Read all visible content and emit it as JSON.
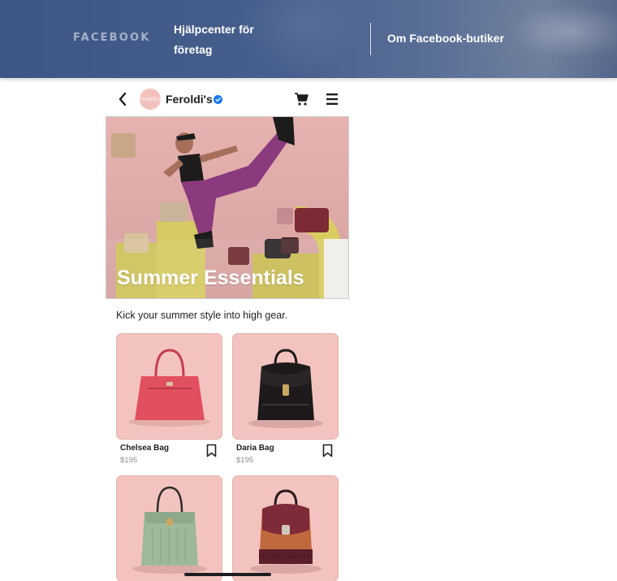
{
  "header": {
    "brand": "FACEBOOK",
    "nav_help": "Hjälpcenter för företag",
    "nav_about": "Om Facebook-butiker"
  },
  "shop": {
    "name": "Feroldi's",
    "avatar_text": "Feroldi's",
    "hero_title": "Summer Essentials",
    "tagline": "Kick your summer style into high gear.",
    "products": [
      {
        "name": "Chelsea Bag",
        "price": "$195",
        "color": "#e24f5f"
      },
      {
        "name": "Daria Bag",
        "price": "$195",
        "color": "#1e1a1c"
      },
      {
        "name": "",
        "price": "",
        "color": "#9db89a"
      },
      {
        "name": "",
        "price": "",
        "color": "#8a2f3c"
      }
    ]
  },
  "icons": {
    "back": "chevron-left-icon",
    "verified": "verified-badge-icon",
    "cart": "cart-icon",
    "menu": "hamburger-menu-icon",
    "bookmark": "bookmark-icon"
  },
  "colors": {
    "header_bg": "#465e8c",
    "verified_blue": "#1877f2",
    "product_bg": "#f3c4bf"
  }
}
